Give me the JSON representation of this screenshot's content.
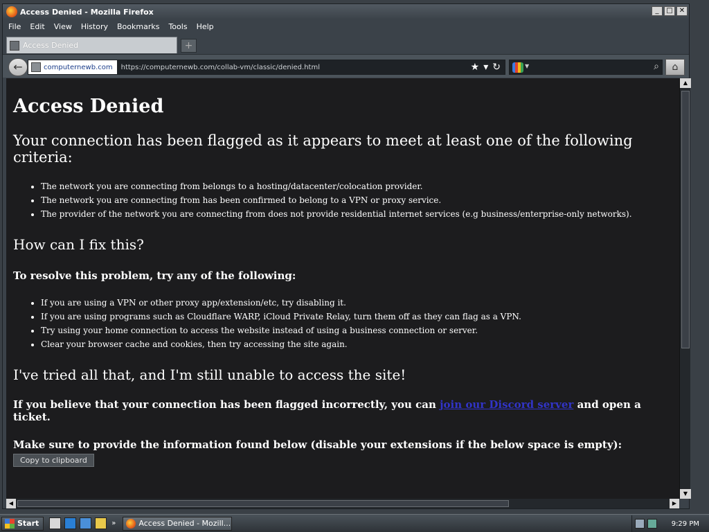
{
  "window": {
    "title": "Access Denied - Mozilla Firefox",
    "buttons": {
      "minimize": "_",
      "maximize": "□",
      "close": "✕"
    }
  },
  "menu": [
    "File",
    "Edit",
    "View",
    "History",
    "Bookmarks",
    "Tools",
    "Help"
  ],
  "tab": {
    "label": "Access Denied",
    "new_tab_symbol": "+"
  },
  "nav": {
    "identity": "computernewb.com",
    "url": "https://computernewb.com/collab-vm/classic/denied.html",
    "icons": [
      "star-icon",
      "dropdown-icon",
      "reload-icon"
    ],
    "search_placeholder": ""
  },
  "page": {
    "title": "Access Denied",
    "flag_heading": "Your connection has been flagged as it appears to meet at least one of the following criteria:",
    "criteria": [
      "The network you are connecting from belongs to a hosting/datacenter/colocation provider.",
      "The network you are connecting from has been confirmed to belong to a VPN or proxy service.",
      "The provider of the network you are connecting from does not provide residential internet services (e.g business/enterprise-only networks)."
    ],
    "fix_heading": "How can I fix this?",
    "resolve_heading": "To resolve this problem, try any of the following:",
    "fixes": [
      "If you are using a VPN or other proxy app/extension/etc, try disabling it.",
      "If you are using programs such as Cloudflare WARP, iCloud Private Relay, turn them off as they can flag as a VPN.",
      "Try using your home connection to access the website instead of using a business connection or server.",
      "Clear your browser cache and cookies, then try accessing the site again."
    ],
    "still_heading": "I've tried all that, and I'm still unable to access the site!",
    "incorrect_prefix": "If you believe that your connection has been flagged incorrectly, you can ",
    "discord_link": "join our Discord server",
    "incorrect_suffix": " and open a ticket.",
    "provide_text": "Make sure to provide the information found below (disable your extensions if the below space is empty):",
    "copy_button": "Copy to clipboard"
  },
  "taskbar": {
    "start": "Start",
    "task_label": "Access Denied - Mozill...",
    "more": "»",
    "clock": "9:29 PM"
  }
}
